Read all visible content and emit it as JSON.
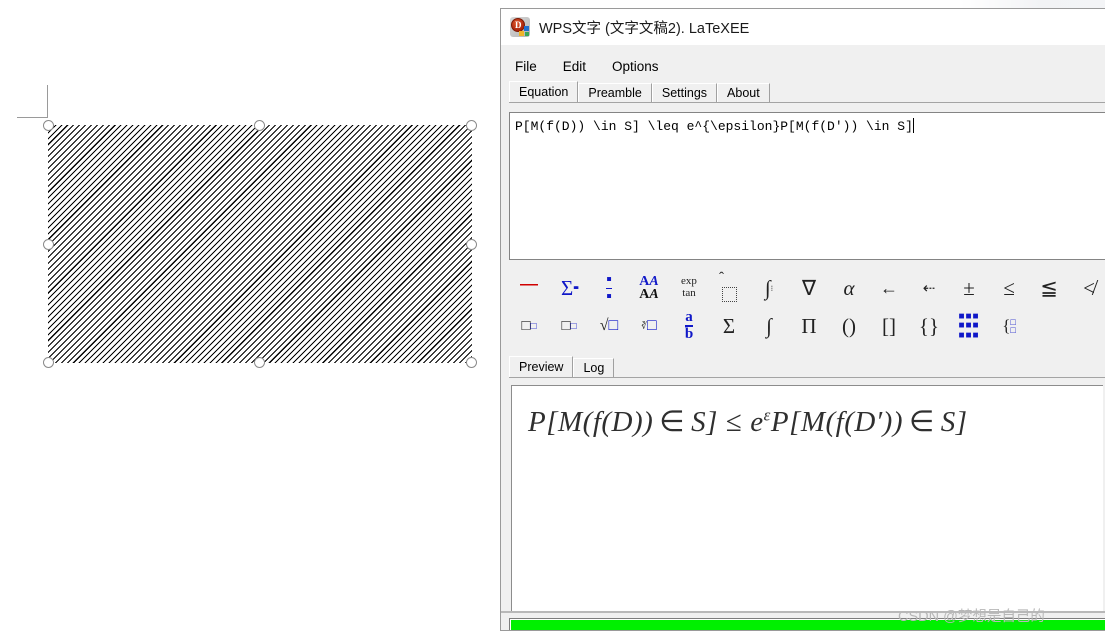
{
  "document": {
    "name": "wps-document-background",
    "selected_object": "hatched-placeholder-image",
    "handles": 8
  },
  "dialog": {
    "title": "WPS文字 (文字文稿2). LaTeXEE",
    "title_icon": "wps-app-icon",
    "menu": [
      {
        "label": "File"
      },
      {
        "label": "Edit"
      },
      {
        "label": "Options"
      }
    ],
    "tabs": [
      {
        "label": "Equation",
        "active": true
      },
      {
        "label": "Preamble",
        "active": false
      },
      {
        "label": "Settings",
        "active": false
      },
      {
        "label": "About",
        "active": false
      }
    ],
    "editor": {
      "value": "P[M(f(D)) \\in S] \\leq e^{\\epsilon}P[M(f(D')) \\in S]",
      "placeholder": ""
    },
    "symbols": {
      "row1": [
        {
          "glyph": "⌐",
          "name": "space-symbol",
          "color": "red"
        },
        {
          "glyph": "∑▪",
          "name": "big-operator-limits-symbol",
          "color": "blue"
        },
        {
          "glyph": "÷",
          "name": "fraction-stack-symbol",
          "color": "blue"
        },
        {
          "glyph": "AA",
          "name": "font-style-symbol",
          "color": "blue"
        },
        {
          "glyph": "exp/tan",
          "name": "math-functions-symbol",
          "color": "dark"
        },
        {
          "glyph": "□̂",
          "name": "accent-hat-symbol",
          "color": "dark"
        },
        {
          "glyph": "∫",
          "name": "integral-limits-symbol",
          "color": "dark"
        },
        {
          "glyph": "∇",
          "name": "nabla-symbol",
          "color": "dark"
        },
        {
          "glyph": "α",
          "name": "greek-alpha-symbol",
          "color": "dark"
        },
        {
          "glyph": "←",
          "name": "left-arrow-symbol",
          "color": "dark"
        },
        {
          "glyph": "⇠",
          "name": "dashed-left-arrow-symbol",
          "color": "dark"
        },
        {
          "glyph": "±",
          "name": "plus-minus-symbol",
          "color": "dark"
        },
        {
          "glyph": "≤",
          "name": "less-equal-symbol",
          "color": "dark"
        },
        {
          "glyph": "≦",
          "name": "less-full-equal-symbol",
          "color": "dark"
        },
        {
          "glyph": "≮",
          "name": "not-less-symbol",
          "color": "dark"
        },
        {
          "glyph": "·",
          "name": "more-symbols-symbol",
          "color": "dark"
        }
      ],
      "row2": [
        {
          "glyph": "□▫",
          "name": "superscript-symbol",
          "color": "dark"
        },
        {
          "glyph": "□▫",
          "name": "subscript-symbol",
          "color": "dark"
        },
        {
          "glyph": "√□",
          "name": "square-root-symbol",
          "color": "blue"
        },
        {
          "glyph": "∛□",
          "name": "nth-root-symbol",
          "color": "blue"
        },
        {
          "glyph": "a/b",
          "name": "fraction-symbol",
          "color": "blue"
        },
        {
          "glyph": "∑",
          "name": "summation-symbol",
          "color": "dark"
        },
        {
          "glyph": "∫",
          "name": "integral-symbol",
          "color": "dark"
        },
        {
          "glyph": "∏",
          "name": "product-symbol",
          "color": "dark"
        },
        {
          "glyph": "()",
          "name": "parentheses-symbol",
          "color": "dark"
        },
        {
          "glyph": "[]",
          "name": "brackets-symbol",
          "color": "dark"
        },
        {
          "glyph": "{}",
          "name": "braces-symbol",
          "color": "dark"
        },
        {
          "glyph": "▒",
          "name": "matrix-symbol",
          "color": "blue"
        },
        {
          "glyph": "{□",
          "name": "cases-symbol",
          "color": "blue"
        }
      ]
    },
    "preview_tabs": [
      {
        "label": "Preview",
        "active": true
      },
      {
        "label": "Log",
        "active": false
      }
    ],
    "preview": {
      "rendered_equation_parts": {
        "p1": "P[M(f(D))",
        "in1": "∈",
        "s1": "S]",
        "leq": "≤",
        "e": "e",
        "eps": "ε",
        "p2": "P[M(f(D′))",
        "in2": "∈",
        "s2": "S]"
      },
      "full_text": "P[M(f(D)) ∈ S] ≤ eεP[M(f(D′)) ∈ S]"
    },
    "progress": {
      "percent": 100,
      "color": "#00f000"
    }
  },
  "watermark": {
    "text": "CSDN @梦想是自己的",
    "color": "#b7b7b7"
  }
}
